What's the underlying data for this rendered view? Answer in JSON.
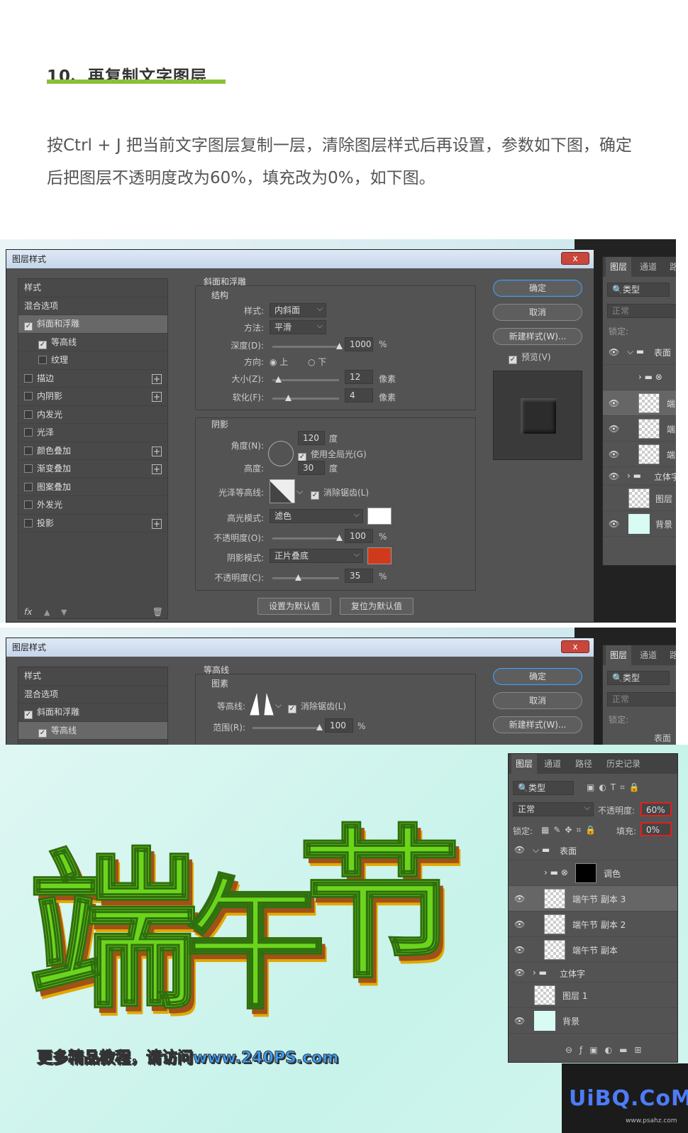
{
  "article": {
    "title": "10、再复制文字图层",
    "paragraph": "按Ctrl + J 把当前文字图层复制一层，清除图层样式后再设置，参数如下图，确定后把图层不透明度改为60%，填充改为0%，如下图。"
  },
  "dialog1": {
    "title": "图层样式",
    "close": "x",
    "list": [
      "样式",
      "混合选项",
      "斜面和浮雕",
      "等高线",
      "纹理",
      "描边",
      "内阴影",
      "内发光",
      "光泽",
      "颜色叠加",
      "渐变叠加",
      "图案叠加",
      "外发光",
      "投影"
    ],
    "section_title": "斜面和浮雕",
    "structure": {
      "heading": "结构",
      "style_label": "样式:",
      "style_value": "内斜面",
      "method_label": "方法:",
      "method_value": "平滑",
      "depth_label": "深度(D):",
      "depth_value": "1000",
      "depth_unit": "%",
      "direction_label": "方向:",
      "dir_up": "上",
      "dir_down": "下",
      "size_label": "大小(Z):",
      "size_value": "12",
      "size_unit": "像素",
      "soften_label": "软化(F):",
      "soften_value": "4",
      "soften_unit": "像素"
    },
    "shading": {
      "heading": "阴影",
      "angle_label": "角度(N):",
      "angle_value": "120",
      "angle_unit": "度",
      "global_light": "使用全局光(G)",
      "altitude_label": "高度:",
      "altitude_value": "30",
      "altitude_unit": "度",
      "gloss_label": "光泽等高线:",
      "antialias": "消除锯齿(L)",
      "highlight_label": "高光模式:",
      "highlight_value": "滤色",
      "opacity1_label": "不透明度(O):",
      "opacity1_value": "100",
      "pct": "%",
      "shadow_label": "阴影模式:",
      "shadow_value": "正片叠底",
      "opacity2_label": "不透明度(C):",
      "opacity2_value": "35",
      "highlight_color": "#ffffff",
      "shadow_color": "#d03a1c"
    },
    "btn_default": "设置为默认值",
    "btn_reset": "复位为默认值",
    "ok": "确定",
    "cancel": "取消",
    "new_style": "新建样式(W)...",
    "preview": "预览(V)"
  },
  "dialog2": {
    "title": "图层样式",
    "close": "x",
    "list": [
      "样式",
      "混合选项",
      "斜面和浮雕",
      "等高线"
    ],
    "section_title": "等高线",
    "sub_heading": "图素",
    "contour_label": "等高线:",
    "antialias": "消除锯齿(L)",
    "range_label": "范围(R):",
    "range_value": "100",
    "pct": "%",
    "ok": "确定",
    "cancel": "取消",
    "new_style": "新建样式(W)..."
  },
  "layers_small": {
    "tabs": [
      "图层",
      "通道",
      "路"
    ],
    "search": "类型",
    "blend": "正常",
    "lock": "锁定:",
    "rows": [
      "表面",
      "",
      "端",
      "端",
      "端",
      "立体字",
      "图层",
      "背景"
    ]
  },
  "layers_small2": {
    "tabs": [
      "图层",
      "通道",
      "路"
    ],
    "search": "类型",
    "blend": "正常",
    "lock": "锁定:",
    "row": "表面"
  },
  "layers_main": {
    "tabs": [
      "图层",
      "通道",
      "路径",
      "历史记录"
    ],
    "search": "类型",
    "blend": "正常",
    "opacity_label": "不透明度:",
    "opacity_value": "60%",
    "lock_label": "锁定:",
    "fill_label": "填充:",
    "fill_value": "0%",
    "rows": [
      "表面",
      "调色",
      "端午节 副本 3",
      "端午节 副本 2",
      "端午节 副本",
      "立体字",
      "图层 1",
      "背景"
    ]
  },
  "banner": {
    "chars": [
      "端",
      "午",
      "节"
    ],
    "footer_prefix": "更多精品教程，请访问",
    "footer_url": "www.240PS.com",
    "logo": "UiBQ.CoM",
    "logo_sub": "www.psahz.com"
  }
}
